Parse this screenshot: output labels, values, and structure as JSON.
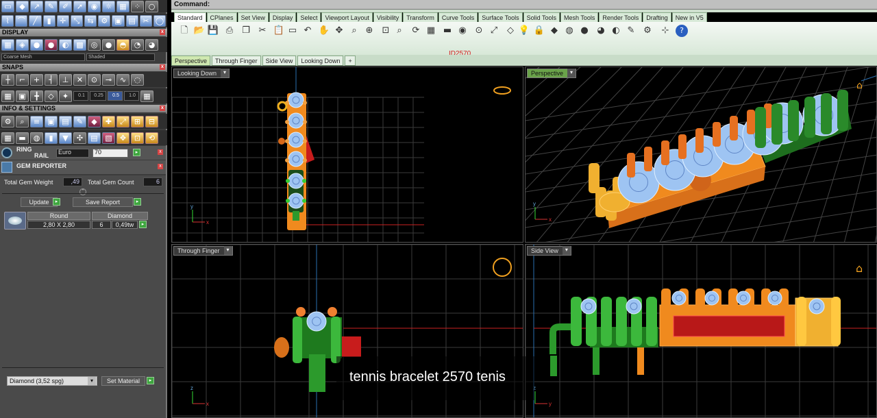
{
  "command": {
    "label": "Command:"
  },
  "panel": {
    "display": {
      "title": "DISPLAY",
      "mesh": "Coarse Mesh",
      "mode": "Shaded"
    },
    "snaps": {
      "title": "SNAPS",
      "values": [
        "0.1",
        "0.25",
        "0.5",
        "1.0"
      ]
    },
    "info": {
      "title": "INFO & SETTINGS"
    },
    "ring_rail": {
      "title": "RING\nRAIL",
      "title_l1": "RING",
      "title_l2": "RAIL",
      "sizing": "Euro",
      "size": "70"
    },
    "gem_reporter": {
      "title": "GEM REPORTER",
      "weight_label": "Total Gem Weight",
      "weight_value": ",49",
      "count_label": "Total Gem Count",
      "count_value": "6",
      "update_label": "Update",
      "save_label": "Save Report",
      "columns": [
        "Round",
        "Diamond"
      ],
      "row": {
        "size": "2,80 X 2,80",
        "count": "6",
        "weight": "0,49tw"
      }
    },
    "material": {
      "value": "Diamond    (3,52 spg)",
      "button": "Set Material"
    }
  },
  "tabs": [
    "Standard",
    "CPlanes",
    "Set View",
    "Display",
    "Select",
    "Viewport Layout",
    "Visibility",
    "Transform",
    "Curve Tools",
    "Surface Tools",
    "Solid Tools",
    "Mesh Tools",
    "Render Tools",
    "Drafting",
    "New in V5"
  ],
  "status": {
    "id": "ID2570"
  },
  "viewport_tabs": [
    "Perspective",
    "Through Finger",
    "Side View",
    "Looking Down",
    "+"
  ],
  "viewports": {
    "top_left": "Looking Down",
    "top_right": "Perspective",
    "bottom_left": "Through Finger",
    "bottom_right": "Side View"
  },
  "axes": {
    "x": "x",
    "y": "y",
    "z": "z"
  },
  "caption": "tennis bracelet 2570 tenis",
  "colors": {
    "gold": "#f08a1e",
    "green": "#2c9a2c",
    "diamond": "#9ec4f2",
    "red": "#c81c1c"
  }
}
